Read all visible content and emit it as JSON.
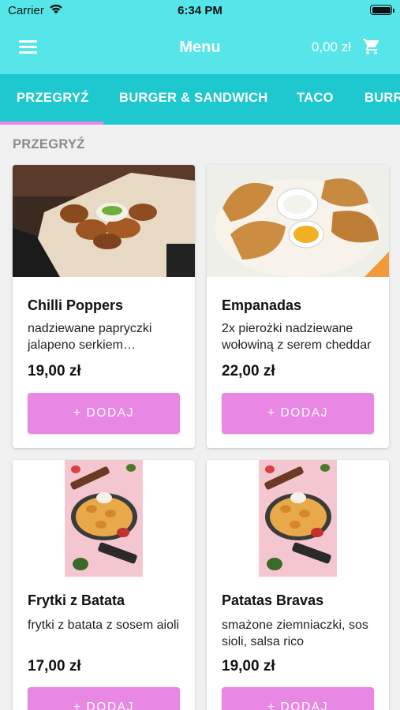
{
  "status_bar": {
    "carrier": "Carrier",
    "time": "6:34 PM"
  },
  "header": {
    "title": "Menu",
    "cart_total": "0,00 zł"
  },
  "tabs": [
    "PRZEGRYŹ",
    "BURGER & SANDWICH",
    "TACO",
    "BURR"
  ],
  "active_tab": "PRZEGRYŹ",
  "section": {
    "title": "PRZEGRYŹ"
  },
  "products": [
    {
      "name": "Chilli Poppers",
      "description": "nadziewane papryczki jalapeno serkiem kremowym",
      "price": "19,00 zł",
      "button": "+ DODAJ"
    },
    {
      "name": "Empanadas",
      "description": "2x pierożki nadziewane wołowiną z serem cheddar",
      "price": "22,00 zł",
      "button": "+ DODAJ"
    },
    {
      "name": "Frytki z Batata",
      "description": "frytki z batata z sosem aioli",
      "price": "17,00 zł",
      "button": "+ DODAJ"
    },
    {
      "name": "Patatas Bravas",
      "description": "smażone ziemniaczki, sos sioli, salsa rico",
      "price": "19,00 zł",
      "button": "+ DODAJ"
    }
  ],
  "colors": {
    "header": "#56e6ea",
    "tabs": "#1ec8cf",
    "accent": "#e987e4"
  },
  "icons": [
    "menu-icon",
    "cart-icon",
    "wifi-icon",
    "battery-icon"
  ]
}
